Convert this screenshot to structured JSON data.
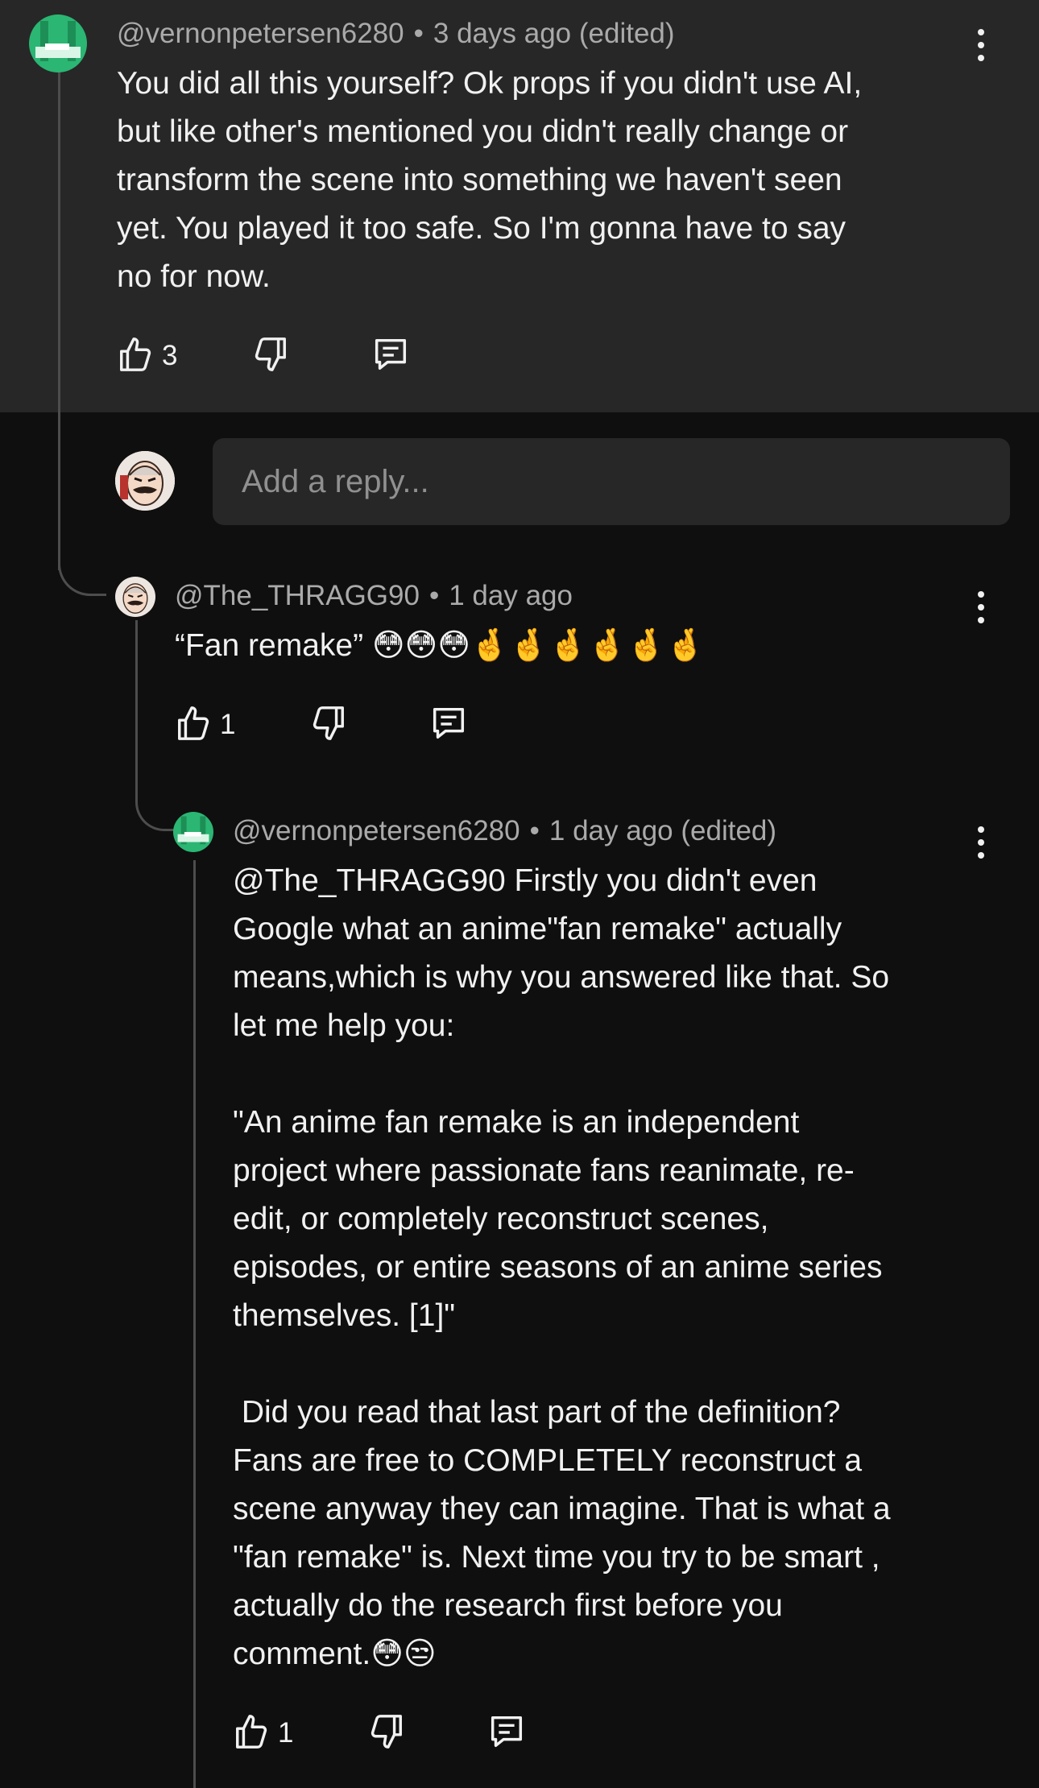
{
  "reply_input": {
    "placeholder": "Add a reply..."
  },
  "comments": [
    {
      "author": "@vernonpetersen6280",
      "time": "3 days ago (edited)",
      "text": "You did all this yourself? Ok props if you didn't use AI,\nbut like other's mentioned you didn't really change or\ntransform the scene into something we haven't seen\nyet. You played it too safe. So I'm gonna have to say\nno for now.",
      "likes": "3",
      "icons": {
        "like": "thumbs-up-icon",
        "dislike": "thumbs-down-icon",
        "reply": "reply-icon",
        "more": "more-vert-icon"
      }
    },
    {
      "author": "@The_THRAGG90",
      "time": "1 day ago",
      "text": "“Fan remake” 😳😳😳🤞🤞🤞🤞🤞🤞",
      "likes": "1"
    },
    {
      "author": "@vernonpetersen6280",
      "time": "1 day ago (edited)",
      "text": "@The_THRAGG90 Firstly you didn't even\nGoogle what an anime\"fan remake\" actually\nmeans,which is why you answered like that. So\nlet me help you:\n\n\"An anime fan remake is an independent\nproject where passionate fans reanimate, re-\nedit, or completely reconstruct scenes,\nepisodes, or entire seasons of an anime series\nthemselves. [1]\"\n\n Did you read that last part of the definition?\nFans are free to COMPLETELY reconstruct a\nscene anyway they can imagine. That is what a\n\"fan remake\" is. Next time you try to be smart ,\nactually do the research first before you\ncomment.😳😒",
      "likes": "1"
    }
  ],
  "colors": {
    "background": "#0f0f0f",
    "highlighted_background": "#272727",
    "meta_text": "#aaaaaa",
    "body_text": "#f1f1f1",
    "green_avatar": "#2bb673"
  }
}
